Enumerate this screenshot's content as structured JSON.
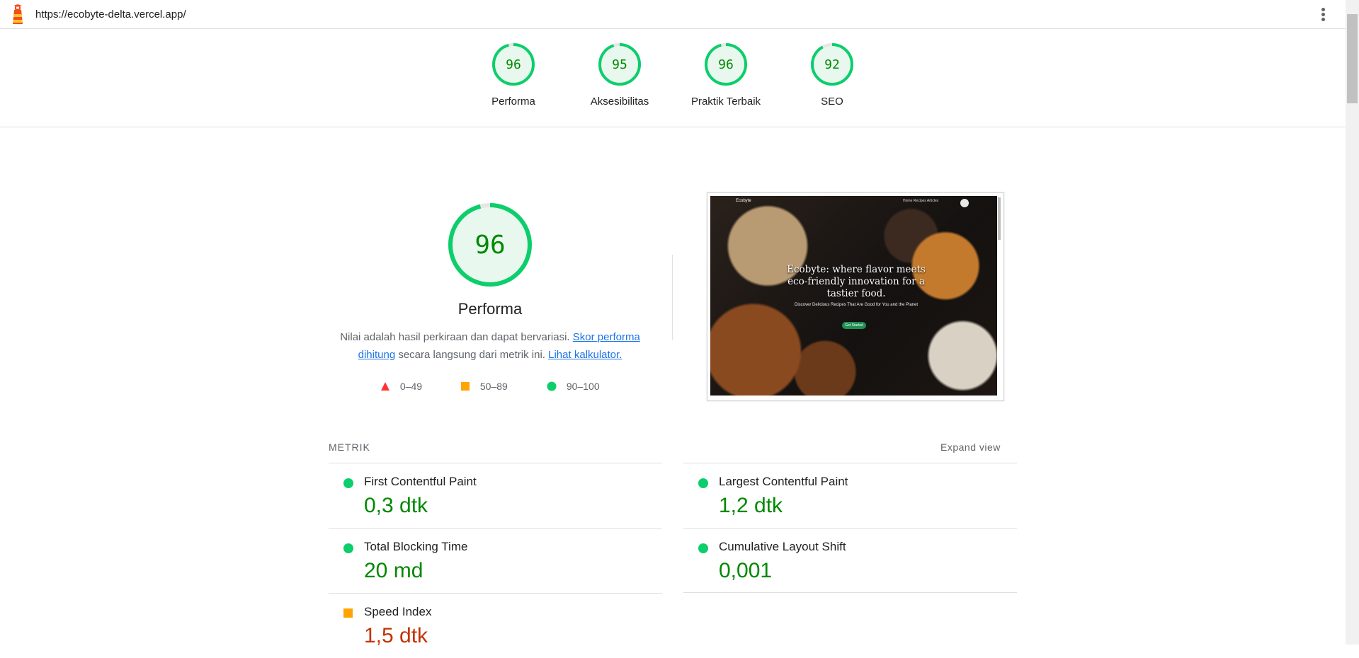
{
  "topbar": {
    "url": "https://ecobyte-delta.vercel.app/"
  },
  "summary": {
    "gauges": [
      {
        "score": "96",
        "label": "Performa"
      },
      {
        "score": "95",
        "label": "Aksesibilitas"
      },
      {
        "score": "96",
        "label": "Praktik Terbaik"
      },
      {
        "score": "92",
        "label": "SEO"
      }
    ]
  },
  "performance": {
    "score": "96",
    "title": "Performa",
    "desc_prefix": "Nilai adalah hasil perkiraan dan dapat bervariasi.",
    "link_skor": "Skor performa dihitung",
    "desc_middle": "secara langsung dari metrik ini.",
    "link_kalkulator": "Lihat kalkulator.",
    "legend": {
      "fail": "0–49",
      "average": "50–89",
      "pass": "90–100"
    },
    "colors": {
      "pass": "#0cce6b",
      "average": "#ffa400",
      "fail": "#ff4e42",
      "pass_text": "#008800",
      "average_text": "#c33300"
    }
  },
  "screenshot": {
    "brand": "Ecobyte",
    "nav_links": "Home   Recipes   Articles",
    "headline": "Ecobyte: where flavor meets eco-friendly innovation for a tastier food.",
    "subtext": "Discover Delicious Recipes That Are Good for You and the Planet",
    "cta": "Get Started"
  },
  "metrics": {
    "heading": "METRIK",
    "expand_label": "Expand view",
    "left": [
      {
        "name": "First Contentful Paint",
        "value": "0,3 dtk",
        "rating": "pass"
      },
      {
        "name": "Total Blocking Time",
        "value": "20 md",
        "rating": "pass"
      },
      {
        "name": "Speed Index",
        "value": "1,5 dtk",
        "rating": "average"
      }
    ],
    "right": [
      {
        "name": "Largest Contentful Paint",
        "value": "1,2 dtk",
        "rating": "pass"
      },
      {
        "name": "Cumulative Layout Shift",
        "value": "0,001",
        "rating": "pass"
      }
    ]
  }
}
